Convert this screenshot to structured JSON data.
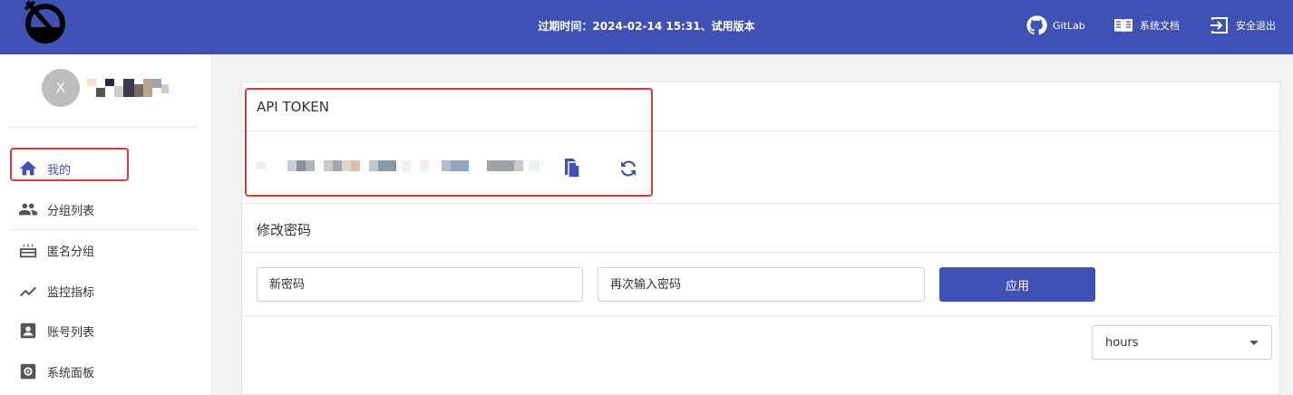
{
  "header": {
    "expire_text": "过期时间：2024-02-14 15:31、试用版本",
    "links": {
      "gitlab": "GitLab",
      "docs": "系统文档",
      "logout": "安全退出"
    },
    "bg_color": "#3f51b5"
  },
  "user": {
    "avatar_letter": "X"
  },
  "sidebar": {
    "items": [
      {
        "label": "我的",
        "icon": "home-icon",
        "active": true
      },
      {
        "label": "分组列表",
        "icon": "group-icon"
      },
      {
        "label": "匿名分组",
        "icon": "cake-icon"
      },
      {
        "label": "监控指标",
        "icon": "trending-icon"
      },
      {
        "label": "账号列表",
        "icon": "account-box-icon"
      },
      {
        "label": "系统面板",
        "icon": "settings-icon"
      }
    ]
  },
  "main": {
    "api_token_title": "API TOKEN",
    "password_title": "修改密码",
    "new_password_placeholder": "新密码",
    "repeat_password_placeholder": "再次输入密码",
    "apply_label": "应用",
    "unit_select_value": "hours"
  },
  "colors": {
    "accent": "#3f51b5",
    "highlight": "#e53935"
  }
}
